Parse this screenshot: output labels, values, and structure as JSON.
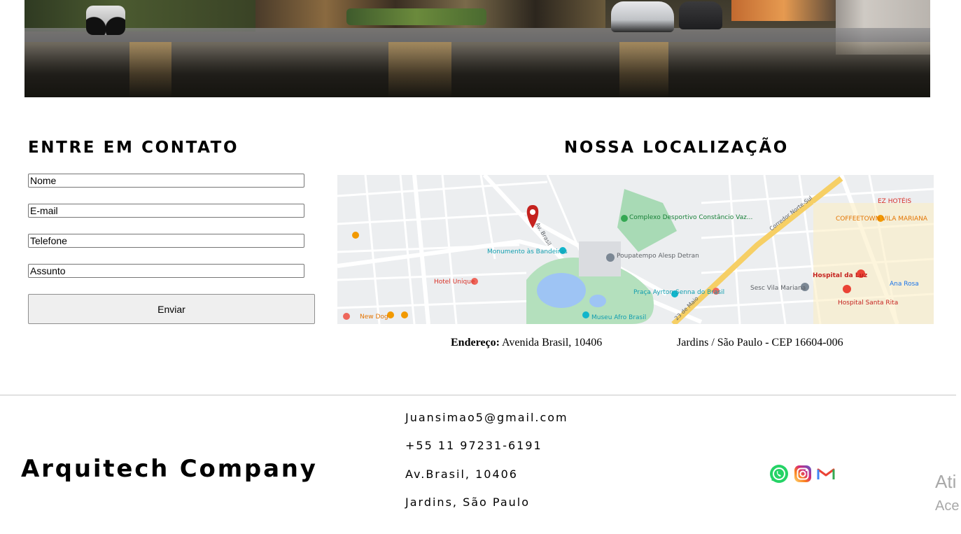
{
  "hero": {
    "alt": "building render"
  },
  "contact": {
    "title": "ENTRE EM CONTATO",
    "fields": [
      {
        "placeholder": "Nome"
      },
      {
        "placeholder": "E-mail"
      },
      {
        "placeholder": "Telefone"
      },
      {
        "placeholder": "Assunto"
      }
    ],
    "submit_label": "Enviar"
  },
  "location": {
    "title": "NOSSA LOCALIZAÇÃO",
    "address_label": "Endereço:",
    "address_value": "Avenida Brasil, 10406",
    "address_city": "Jardins / São Paulo - CEP 16604-006",
    "map": {
      "pois": [
        "Complexo Desportivo Constâncio Vaz...",
        "Monumento às Bandeiras",
        "Poupatempo Alesp Detran",
        "Hotel Unique",
        "Praça Ayrton Senna do Brasil",
        "Museu Afro Brasil",
        "New Dog",
        "Hospital da Luz",
        "Hospital Santa Rita",
        "Sesc Vila Mariana",
        "COFFEETOWN VILA MARIANA",
        "EZ HOTÉIS",
        "Ana Rosa",
        "Corredor Norte-Sul",
        "Av. Brasil",
        "23 de Maio"
      ]
    }
  },
  "footer": {
    "brand": "Arquitech Company",
    "email": "Juansimao5@gmail.com",
    "phone": "+55 11 97231-6191",
    "street": "Av.Brasil, 10406",
    "district": "Jardins, São Paulo",
    "social": [
      "whatsapp-icon",
      "instagram-icon",
      "gmail-icon"
    ]
  },
  "watermark": {
    "line1": "Ati",
    "line2": "Ace"
  }
}
